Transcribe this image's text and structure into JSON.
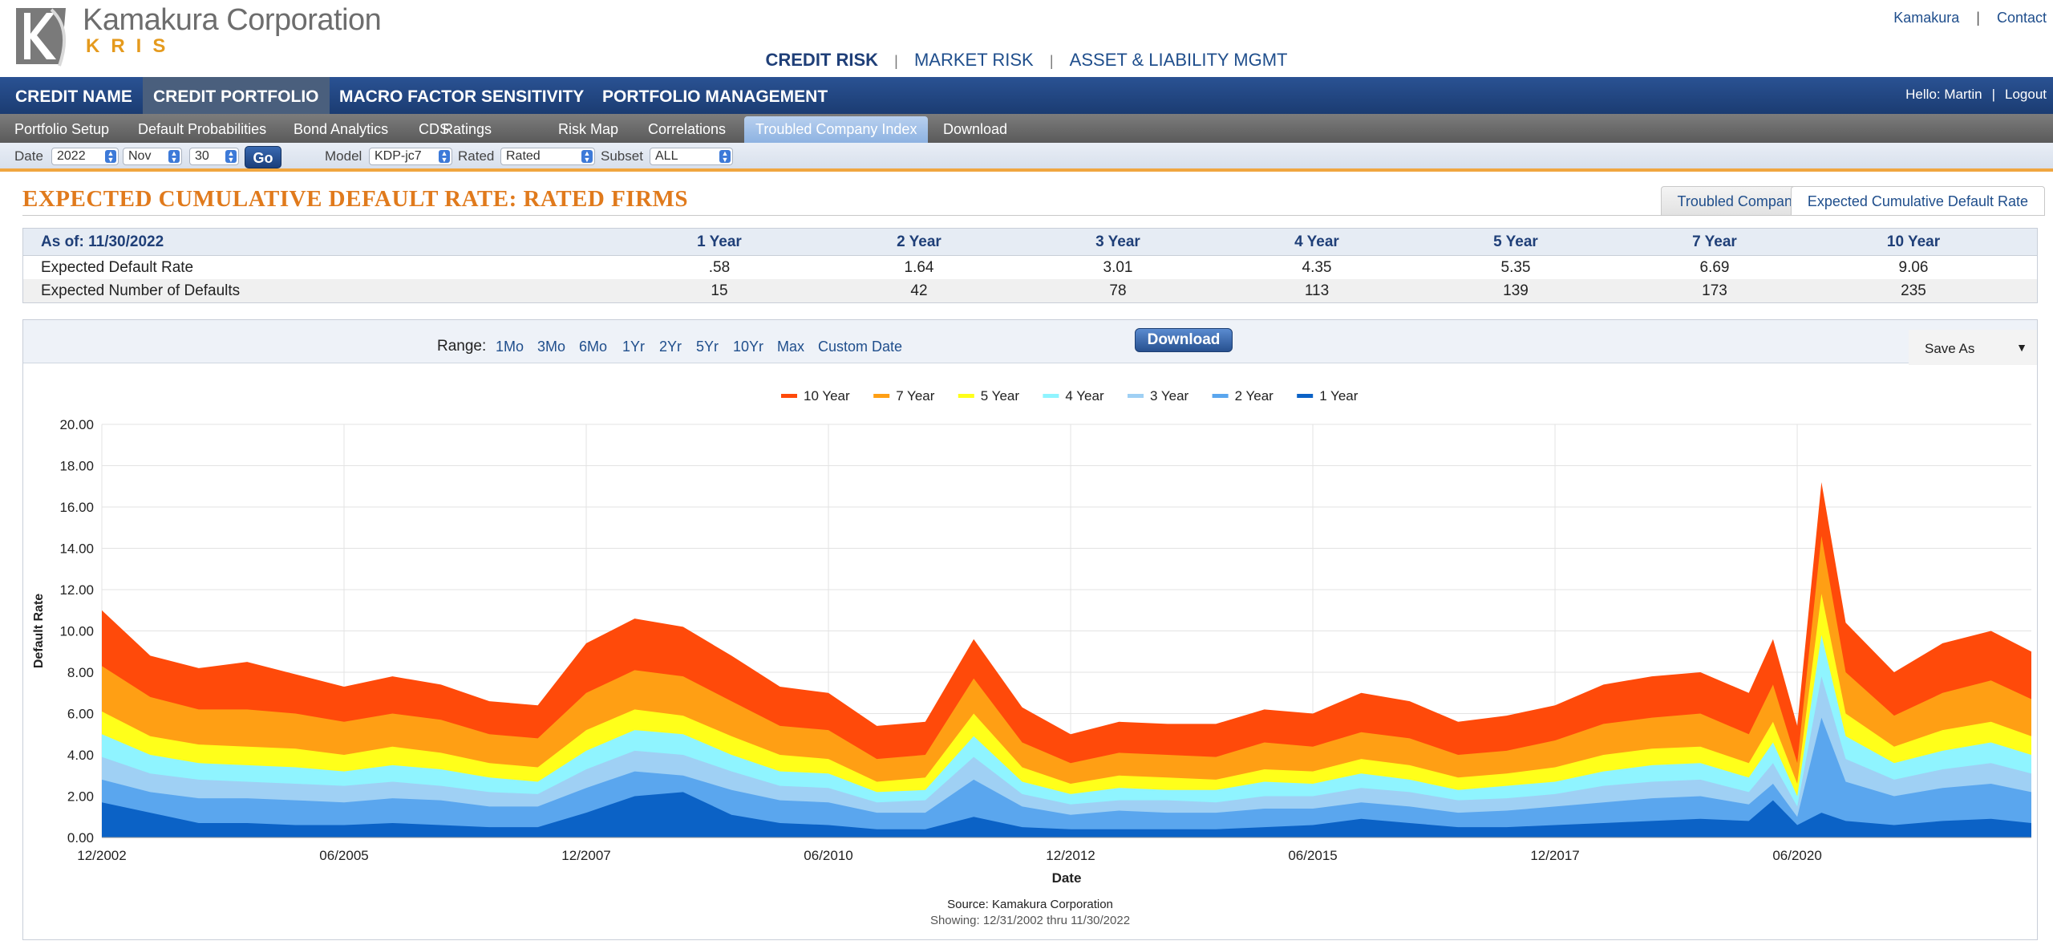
{
  "brand": {
    "name": "Kamakura Corporation",
    "sub": "KRIS"
  },
  "top_links": [
    "Kamakura",
    "Contact"
  ],
  "risk_nav": [
    "CREDIT RISK",
    "MARKET RISK",
    "ASSET & LIABILITY MGMT"
  ],
  "main_nav": [
    "CREDIT NAME",
    "CREDIT PORTFOLIO",
    "MACRO FACTOR SENSITIVITY",
    "PORTFOLIO MANAGEMENT"
  ],
  "greeting": {
    "hello": "Hello: Martin",
    "logout": "Logout"
  },
  "sub_nav": [
    "Portfolio Setup",
    "Default Probabilities",
    "Bond Analytics",
    "CDS",
    "Ratings",
    "Risk Map",
    "Correlations",
    "Troubled Company Index",
    "Download"
  ],
  "filters": {
    "date_label": "Date",
    "year": "2022",
    "month": "Nov",
    "day": "30",
    "go": "Go",
    "model_label": "Model",
    "model": "KDP-jc7",
    "rated_label": "Rated",
    "rated": "Rated",
    "subset_label": "Subset",
    "subset": "ALL"
  },
  "page_title": "EXPECTED CUMULATIVE DEFAULT RATE: RATED FIRMS",
  "view_tabs": [
    "Troubled Company Index",
    "Expected Cumulative Default Rate"
  ],
  "summary": {
    "as_of": "As of: 11/30/2022",
    "headers": [
      "1 Year",
      "2 Year",
      "3 Year",
      "4 Year",
      "5 Year",
      "7 Year",
      "10 Year"
    ],
    "rows": [
      {
        "label": "Expected Default Rate",
        "values": [
          ".58",
          "1.64",
          "3.01",
          "4.35",
          "5.35",
          "6.69",
          "9.06"
        ]
      },
      {
        "label": "Expected Number of Defaults",
        "values": [
          "15",
          "42",
          "78",
          "113",
          "139",
          "173",
          "235"
        ]
      }
    ]
  },
  "toolbar": {
    "range_label": "Range:",
    "ranges": [
      "1Mo",
      "3Mo",
      "6Mo",
      "1Yr",
      "2Yr",
      "5Yr",
      "10Yr",
      "Max",
      "Custom Date"
    ],
    "download": "Download",
    "save_as": "Save As"
  },
  "source": "Source: Kamakura Corporation",
  "showing": "Showing: 12/31/2002 thru 11/30/2022",
  "chart_data": {
    "type": "area",
    "ylabel": "Default Rate",
    "xlabel": "Date",
    "ylim": [
      0,
      20
    ],
    "y_ticks": [
      "0.00",
      "2.00",
      "4.00",
      "6.00",
      "8.00",
      "10.00",
      "12.00",
      "14.00",
      "16.00",
      "18.00",
      "20.00"
    ],
    "x_ticks": [
      "12/2002",
      "06/2005",
      "12/2007",
      "06/2010",
      "12/2012",
      "06/2015",
      "12/2017",
      "06/2020"
    ],
    "x_range": [
      "12/2002",
      "11/2022"
    ],
    "legend_position": "top-center",
    "grid": true,
    "series": [
      {
        "name": "10 Year",
        "color": "#ff4a0a"
      },
      {
        "name": "7 Year",
        "color": "#ff9f14"
      },
      {
        "name": "5 Year",
        "color": "#ffff1a"
      },
      {
        "name": "4 Year",
        "color": "#8ff4ff"
      },
      {
        "name": "3 Year",
        "color": "#9fd0f4"
      },
      {
        "name": "2 Year",
        "color": "#5aa6ee"
      },
      {
        "name": "1 Year",
        "color": "#0b62c6"
      }
    ],
    "x": [
      "12/2002",
      "06/2003",
      "12/2003",
      "06/2004",
      "12/2004",
      "06/2005",
      "12/2005",
      "06/2006",
      "12/2006",
      "06/2007",
      "12/2007",
      "06/2008",
      "12/2008",
      "06/2009",
      "12/2009",
      "06/2010",
      "12/2010",
      "06/2011",
      "12/2011",
      "06/2012",
      "12/2012",
      "06/2013",
      "12/2013",
      "06/2014",
      "12/2014",
      "06/2015",
      "12/2015",
      "06/2016",
      "12/2016",
      "06/2017",
      "12/2017",
      "06/2018",
      "12/2018",
      "06/2019",
      "12/2019",
      "03/2020",
      "06/2020",
      "09/2020",
      "12/2020",
      "06/2021",
      "12/2021",
      "06/2022",
      "11/2022"
    ],
    "values_10yr": [
      11.0,
      8.8,
      8.2,
      8.5,
      7.9,
      7.3,
      7.8,
      7.4,
      6.6,
      6.4,
      9.4,
      10.6,
      10.2,
      8.8,
      7.3,
      7.0,
      5.4,
      5.6,
      9.6,
      6.3,
      5.0,
      5.6,
      5.5,
      5.5,
      6.2,
      6.0,
      7.0,
      6.6,
      5.6,
      5.9,
      6.4,
      7.4,
      7.8,
      8.0,
      7.0,
      9.6,
      5.4,
      17.2,
      10.4,
      8.0,
      9.4,
      10.0,
      9.0
    ],
    "values_7yr": [
      8.3,
      6.8,
      6.2,
      6.2,
      6.0,
      5.6,
      6.0,
      5.7,
      5.0,
      4.8,
      7.0,
      8.1,
      7.8,
      6.6,
      5.4,
      5.2,
      3.8,
      4.0,
      7.7,
      4.6,
      3.6,
      4.1,
      4.0,
      3.9,
      4.6,
      4.4,
      5.1,
      4.8,
      4.0,
      4.2,
      4.7,
      5.5,
      5.8,
      6.0,
      5.0,
      7.4,
      3.6,
      14.6,
      8.0,
      5.9,
      7.0,
      7.6,
      6.7
    ],
    "values_5yr": [
      6.1,
      4.9,
      4.5,
      4.4,
      4.3,
      4.0,
      4.4,
      4.1,
      3.6,
      3.4,
      5.2,
      6.2,
      5.9,
      4.9,
      4.0,
      3.8,
      2.7,
      2.9,
      6.0,
      3.4,
      2.6,
      3.0,
      2.9,
      2.8,
      3.3,
      3.2,
      3.8,
      3.5,
      2.9,
      3.1,
      3.4,
      4.0,
      4.3,
      4.4,
      3.6,
      5.6,
      2.6,
      11.8,
      6.0,
      4.4,
      5.2,
      5.6,
      4.9
    ],
    "values_4yr": [
      5.0,
      4.0,
      3.6,
      3.5,
      3.4,
      3.2,
      3.5,
      3.3,
      2.9,
      2.7,
      4.2,
      5.2,
      5.0,
      4.0,
      3.2,
      3.1,
      2.2,
      2.3,
      4.9,
      2.7,
      2.1,
      2.4,
      2.3,
      2.3,
      2.7,
      2.6,
      3.1,
      2.8,
      2.3,
      2.5,
      2.7,
      3.2,
      3.5,
      3.6,
      2.9,
      4.6,
      2.0,
      9.8,
      4.9,
      3.6,
      4.2,
      4.6,
      4.0
    ],
    "values_3yr": [
      3.9,
      3.1,
      2.8,
      2.7,
      2.6,
      2.5,
      2.7,
      2.5,
      2.2,
      2.1,
      3.3,
      4.2,
      4.0,
      3.2,
      2.5,
      2.4,
      1.7,
      1.8,
      3.9,
      2.1,
      1.6,
      1.8,
      1.8,
      1.7,
      2.0,
      2.0,
      2.4,
      2.2,
      1.8,
      1.9,
      2.1,
      2.5,
      2.7,
      2.8,
      2.2,
      3.6,
      1.5,
      7.8,
      3.8,
      2.8,
      3.3,
      3.6,
      3.1
    ],
    "values_2yr": [
      2.8,
      2.2,
      1.9,
      1.9,
      1.8,
      1.7,
      1.9,
      1.8,
      1.5,
      1.5,
      2.4,
      3.2,
      3.0,
      2.3,
      1.8,
      1.7,
      1.2,
      1.2,
      2.8,
      1.5,
      1.1,
      1.3,
      1.2,
      1.2,
      1.4,
      1.4,
      1.7,
      1.5,
      1.2,
      1.3,
      1.5,
      1.7,
      1.9,
      2.0,
      1.6,
      2.6,
      1.0,
      5.8,
      2.7,
      2.0,
      2.4,
      2.6,
      2.2
    ],
    "values_1yr": [
      1.7,
      1.2,
      0.7,
      0.7,
      0.6,
      0.6,
      0.7,
      0.6,
      0.5,
      0.5,
      1.2,
      2.0,
      2.2,
      1.1,
      0.7,
      0.6,
      0.4,
      0.4,
      1.0,
      0.5,
      0.4,
      0.4,
      0.4,
      0.4,
      0.5,
      0.6,
      0.9,
      0.7,
      0.5,
      0.5,
      0.6,
      0.7,
      0.8,
      0.9,
      0.8,
      1.8,
      0.6,
      1.2,
      0.8,
      0.6,
      0.8,
      0.9,
      0.7
    ]
  }
}
